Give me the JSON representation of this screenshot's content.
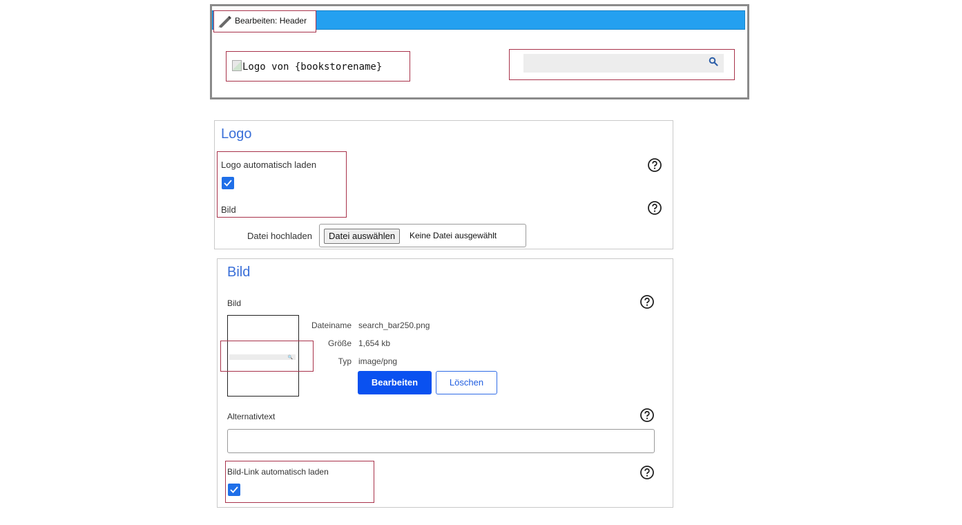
{
  "header_preview": {
    "edit_tab_label": "Bearbeiten: Header",
    "logo_alt_text": "Logo von {bookstorename}",
    "bar_color": "#24a0f0",
    "search_icon": "search-icon"
  },
  "logo_section": {
    "title": "Logo",
    "auto_load_label": "Logo automatisch laden",
    "auto_load_checked": true,
    "image_label": "Bild",
    "upload_label": "Datei hochladen",
    "file_button_label": "Datei auswählen",
    "file_status": "Keine Datei ausgewählt"
  },
  "image_section": {
    "title": "Bild",
    "image_label": "Bild",
    "meta": [
      {
        "key": "Dateiname",
        "value": "search_bar250.png"
      },
      {
        "key": "Größe",
        "value": "1,654 kb"
      },
      {
        "key": "Typ",
        "value": "image/png"
      }
    ],
    "edit_button": "Bearbeiten",
    "delete_button": "Löschen",
    "alt_text_label": "Alternativtext",
    "alt_text_value": "",
    "link_auto_load_label": "Bild-Link automatisch laden",
    "link_auto_load_checked": true
  },
  "colors": {
    "accent_blue": "#0a51f0",
    "title_blue": "#3a6fd8",
    "highlight_red": "#a8324a"
  }
}
